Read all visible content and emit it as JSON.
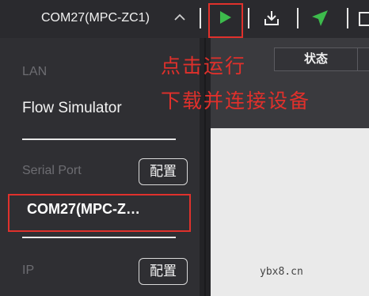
{
  "toolbar": {
    "device_name": "COM27(MPC-ZC1)",
    "icons": [
      "chevron-up-icon",
      "play-icon",
      "download-icon",
      "send-icon"
    ]
  },
  "sidebar": {
    "lan_label": "LAN",
    "flow_simulator": "Flow Simulator",
    "serial_label": "Serial Port",
    "serial_config": "配置",
    "serial_port_value": "COM27(MPC-Z…",
    "ip_label": "IP",
    "ip_config": "配置"
  },
  "right_panel": {
    "status_tab": "状态"
  },
  "annotation": {
    "line1": "点击运行",
    "line2": "下载并连接设备"
  },
  "watermark": "ybx8.cn",
  "colors": {
    "accent_green": "#3dbb4c",
    "highlight_red": "#e0312c",
    "background": "#2f2f33"
  }
}
